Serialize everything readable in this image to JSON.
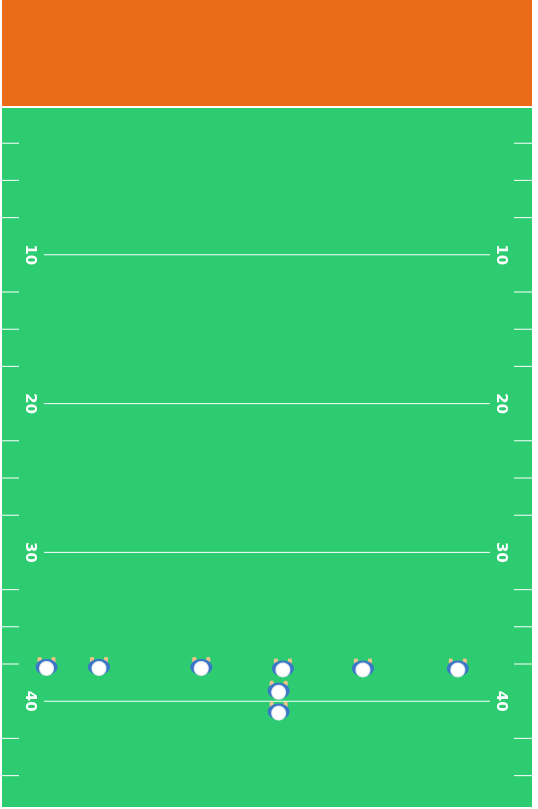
{
  "colors": {
    "endzone": "#ea6c18",
    "field": "#2ecc71",
    "lines": "#ffffff",
    "jersey": "#3a78c7",
    "helmet": "#ffffff",
    "skin": "#f2c48a",
    "frame": "#ffffff"
  },
  "field": {
    "yard_labels": [
      {
        "label": "10",
        "yard": 10
      },
      {
        "label": "20",
        "yard": 20
      },
      {
        "label": "30",
        "yard": 30
      },
      {
        "label": "40",
        "yard": 40
      }
    ]
  },
  "players": [
    {
      "name": "player-left-1",
      "yard": 37.7,
      "lateral": 0.084
    },
    {
      "name": "player-left-2",
      "yard": 37.7,
      "lateral": 0.183
    },
    {
      "name": "player-left-3",
      "yard": 37.7,
      "lateral": 0.376
    },
    {
      "name": "player-center",
      "yard": 37.8,
      "lateral": 0.53
    },
    {
      "name": "player-right-1",
      "yard": 37.8,
      "lateral": 0.681
    },
    {
      "name": "player-right-2",
      "yard": 37.8,
      "lateral": 0.86
    },
    {
      "name": "player-back-1",
      "yard": 39.3,
      "lateral": 0.522
    },
    {
      "name": "player-back-2",
      "yard": 40.7,
      "lateral": 0.522
    }
  ]
}
